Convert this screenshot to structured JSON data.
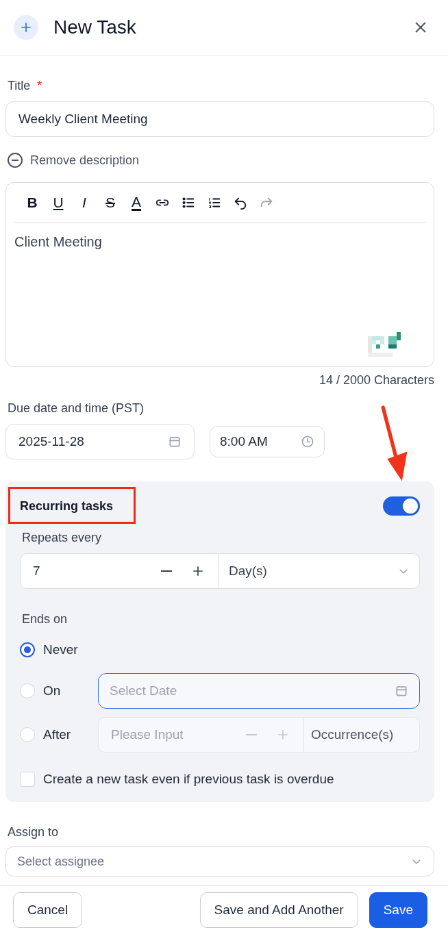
{
  "header": {
    "title": "New Task"
  },
  "title_field": {
    "label": "Title",
    "required_mark": "*",
    "value": "Weekly Client Meeting"
  },
  "remove_description": "Remove description",
  "editor": {
    "toolbar": [
      {
        "kind": "bold",
        "glyph": "B",
        "disabled": false
      },
      {
        "kind": "underline",
        "glyph": "U",
        "disabled": false
      },
      {
        "kind": "italic",
        "glyph": "I",
        "disabled": false
      },
      {
        "kind": "strike",
        "glyph": "S",
        "disabled": false
      },
      {
        "kind": "color",
        "glyph": "A",
        "disabled": false
      },
      {
        "kind": "link",
        "disabled": false
      },
      {
        "kind": "bullets",
        "disabled": false
      },
      {
        "kind": "numbered",
        "disabled": false
      },
      {
        "kind": "undo",
        "disabled": false
      },
      {
        "kind": "redo",
        "disabled": true
      }
    ],
    "content": "Client Meeting",
    "counter": "14 / 2000 Characters"
  },
  "due": {
    "label": "Due date and time (PST)",
    "date": "2025-11-28",
    "time": "8:00 AM"
  },
  "recurring": {
    "title": "Recurring tasks",
    "on": true,
    "repeats_label": "Repeats every",
    "interval": "7",
    "unit": "Day(s)",
    "ends_label": "Ends on",
    "options": [
      {
        "kind": "plain",
        "label": "Never",
        "selected": true
      },
      {
        "kind": "date",
        "label": "On",
        "selected": false,
        "placeholder": "Select Date"
      },
      {
        "kind": "count",
        "label": "After",
        "selected": false,
        "placeholder": "Please Input",
        "suffix": "Occurrence(s)"
      }
    ],
    "overdue": {
      "label": "Create a new task even if previous task is overdue",
      "checked": false
    }
  },
  "assign": {
    "label": "Assign to",
    "placeholder": "Select assignee"
  },
  "footer": {
    "buttons": [
      {
        "kind": "default",
        "label": "Cancel"
      },
      {
        "kind": "default",
        "label": "Save and Add Another"
      },
      {
        "kind": "primary",
        "label": "Save"
      }
    ]
  }
}
